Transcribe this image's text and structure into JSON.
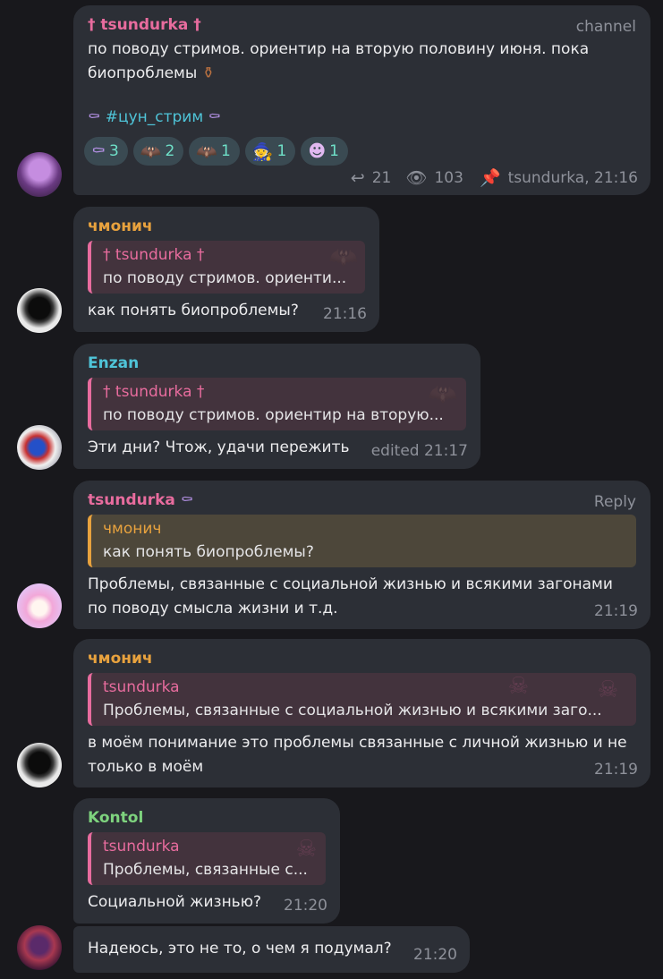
{
  "messages": {
    "m1": {
      "sender": "† tsundurka †",
      "tag": "channel",
      "text": "по поводу стримов. ориентир на вторую половину июня. пока биопроблемы",
      "emoji": "⚱",
      "hashtag": "#цун_стрим",
      "reactions": [
        {
          "icon": "⚰",
          "count": "3"
        },
        {
          "icon": "🦇",
          "count": "2"
        },
        {
          "icon": "🦇",
          "count": "1"
        },
        {
          "icon": "🧙",
          "count": "1"
        },
        {
          "icon": "☻",
          "count": "1"
        }
      ],
      "replies": "21",
      "views": "103",
      "signature": "tsundurka, 21:16"
    },
    "m2": {
      "sender": "чмонич",
      "quote_name": "† tsundurka †",
      "quote_text": "по поводу стримов. ориенти...",
      "text": "как понять биопроблемы?",
      "time": "21:16"
    },
    "m3": {
      "sender": "Enzan",
      "quote_name": "† tsundurka †",
      "quote_text": "по поводу стримов. ориентир на вторую...",
      "text": "Эти дни? Чтож, удачи пережить",
      "time": "edited 21:17"
    },
    "m4": {
      "sender": "tsundurka",
      "tag": "Reply",
      "quote_name": "чмонич",
      "quote_text": "как понять биопроблемы?",
      "text": "Проблемы, связанные с социальной жизнью и всякими загонами по поводу смысла жизни и т.д.",
      "time": "21:19"
    },
    "m5": {
      "sender": "чмонич",
      "quote_name": "tsundurka",
      "quote_text": "Проблемы, связанные с социальной жизнью и всякими заго...",
      "text": "в моём понимание это проблемы связанные с личной жизнью и не только в моём",
      "time": "21:19"
    },
    "m6": {
      "sender": "Kontol",
      "quote_name": "tsundurka",
      "quote_text": "Проблемы, связанные с...",
      "text": "Социальной жизнью?",
      "time": "21:20"
    },
    "m7": {
      "text": "Надеюсь, это не то, о чем я подумал?",
      "time": "21:20"
    }
  }
}
